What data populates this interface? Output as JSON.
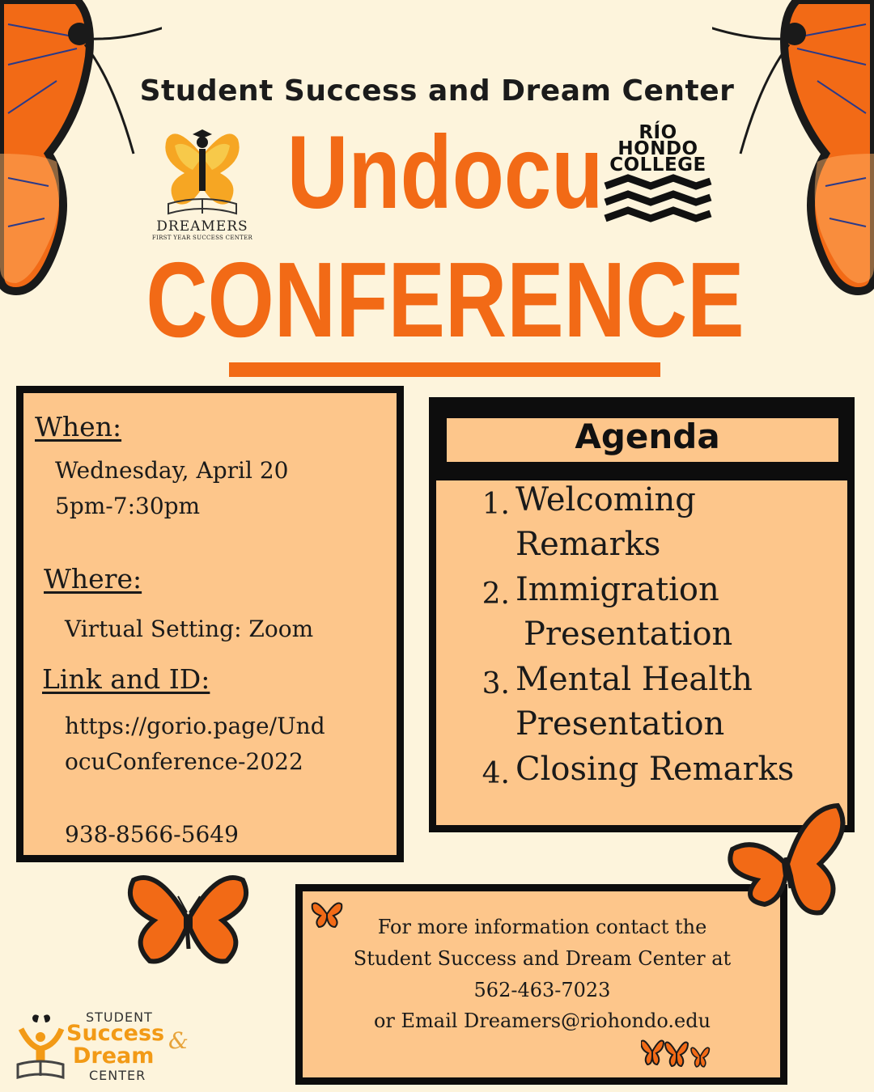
{
  "header": {
    "organization": "Student Success and Dream Center",
    "title_line1": "Undocu",
    "title_line2": "CONFERENCE"
  },
  "logos": {
    "dreamers": {
      "name": "DREAMERS",
      "subtitle": "FIRST YEAR SUCCESS CENTER"
    },
    "college": {
      "line1": "RÍO",
      "line2": "HONDO",
      "line3": "COLLEGE"
    },
    "ssdc": {
      "line1": "STUDENT",
      "line2": "Success",
      "ampersand": "&",
      "line3": "Dream",
      "line4": "CENTER"
    }
  },
  "details": {
    "when_label": "When:",
    "date": "Wednesday, April 20",
    "time": "5pm-7:30pm",
    "where_label": "Where:",
    "location": "Virtual Setting: Zoom",
    "link_label": "Link and ID:",
    "link_line1": "https://gorio.page/Und",
    "link_line2": "ocuConference-2022",
    "meeting_id": "938-8566-5649"
  },
  "agenda": {
    "title": "Agenda",
    "items": [
      {
        "num": "1.",
        "line1": "Welcoming",
        "line2": "Remarks"
      },
      {
        "num": "2.",
        "line1": "Immigration",
        "line2": "Presentation"
      },
      {
        "num": "3.",
        "line1": "Mental Health",
        "line2": "Presentation"
      },
      {
        "num": "4.",
        "line1": "Closing Remarks",
        "line2": ""
      }
    ]
  },
  "contact": {
    "line1": "For more information contact the",
    "line2": "Student Success and Dream Center at",
    "phone": "562-463-7023",
    "email_line": "or Email Dreamers@riohondo.edu"
  },
  "colors": {
    "background": "#fdf4dc",
    "accent_orange": "#f26a16",
    "panel_fill": "#fdc68b",
    "border": "#0d0d0d"
  },
  "icons": [
    "butterfly-icon",
    "book-icon",
    "waves-icon"
  ]
}
